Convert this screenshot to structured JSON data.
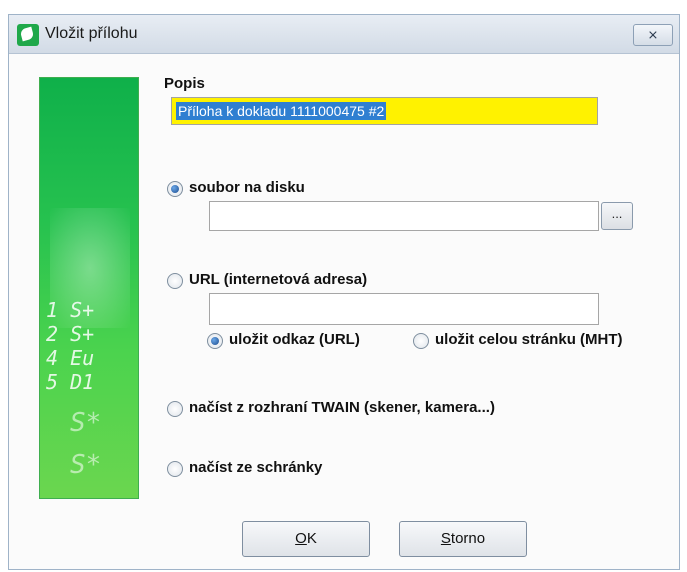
{
  "window": {
    "title": "Vložit přílohu",
    "close_symbol": "⨯"
  },
  "banner": {
    "digits": [
      "1 S+",
      "2 S+",
      "4 Eu",
      "5 D1"
    ],
    "signs": [
      "S*",
      "S*"
    ]
  },
  "popis": {
    "label": "Popis",
    "value": "Příloha k dokladu 1111000475 #2"
  },
  "options": {
    "file": {
      "label": "soubor na disku",
      "selected": true,
      "browse_label": "..."
    },
    "url": {
      "label": "URL (internetová adresa)",
      "selected": false
    },
    "url_save_link": {
      "label": "uložit odkaz (URL)",
      "selected": true
    },
    "url_save_page": {
      "label": "uložit celou stránku (MHT)",
      "selected": false
    },
    "twain": {
      "label": "načíst z rozhraní TWAIN (skener, kamera...)",
      "selected": false
    },
    "clipboard": {
      "label": "načíst ze schránky",
      "selected": false
    }
  },
  "buttons": {
    "ok": {
      "accel": "O",
      "rest": "K"
    },
    "cancel": {
      "accel": "S",
      "rest": "torno"
    }
  }
}
